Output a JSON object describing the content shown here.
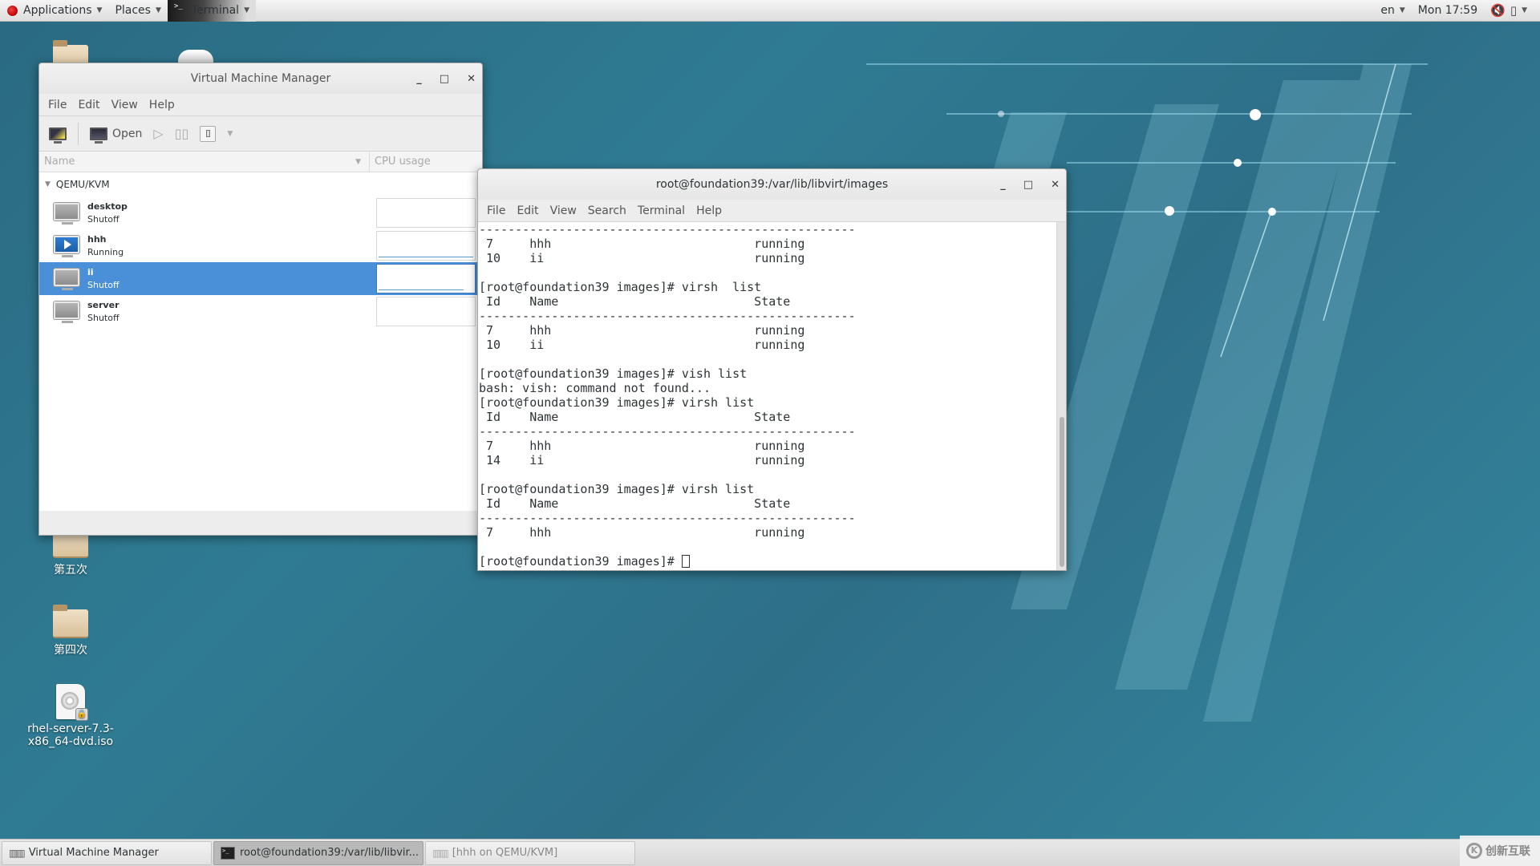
{
  "top_bar": {
    "applications_label": "Applications",
    "places_label": "Places",
    "active_app_label": "Terminal",
    "language": "en",
    "clock": "Mon 17:59",
    "icons": {
      "applications": "redhat-logo-icon",
      "volume": "volume-muted-icon",
      "battery": "battery-icon",
      "menu": "chevron-down-icon"
    }
  },
  "desktop": {
    "icons": [
      {
        "label": "",
        "type": "home-folder"
      },
      {
        "label": "",
        "type": "disk"
      },
      {
        "label": "第五次",
        "type": "folder"
      },
      {
        "label": "第四次",
        "type": "folder"
      },
      {
        "label": "rhel-server-7.3-x86_64-dvd.iso",
        "line1": "rhel-server-7.3-",
        "line2": "x86_64-dvd.iso",
        "type": "iso"
      }
    ]
  },
  "vmm": {
    "title": "Virtual Machine Manager",
    "menu": [
      "File",
      "Edit",
      "View",
      "Help"
    ],
    "toolbar": {
      "open_label": "Open"
    },
    "columns": {
      "name": "Name",
      "cpu": "CPU usage"
    },
    "group": "QEMU/KVM",
    "vms": [
      {
        "name": "desktop",
        "status": "Shutoff",
        "running": false,
        "selected": false
      },
      {
        "name": "hhh",
        "status": "Running",
        "running": true,
        "selected": false
      },
      {
        "name": "ii",
        "status": "Shutoff",
        "running": false,
        "selected": true
      },
      {
        "name": "server",
        "status": "Shutoff",
        "running": false,
        "selected": false
      }
    ],
    "accent_color": "#4a90d9"
  },
  "terminal": {
    "title": "root@foundation39:/var/lib/libvirt/images",
    "menu": [
      "File",
      "Edit",
      "View",
      "Search",
      "Terminal",
      "Help"
    ],
    "lines": [
      "----------------------------------------------------",
      " 7     hhh                            running",
      " 10    ii                             running",
      "",
      "[root@foundation39 images]# virsh  list",
      " Id    Name                           State",
      "----------------------------------------------------",
      " 7     hhh                            running",
      " 10    ii                             running",
      "",
      "[root@foundation39 images]# vish list",
      "bash: vish: command not found...",
      "[root@foundation39 images]# virsh list",
      " Id    Name                           State",
      "----------------------------------------------------",
      " 7     hhh                            running",
      " 14    ii                             running",
      "",
      "[root@foundation39 images]# virsh list",
      " Id    Name                           State",
      "----------------------------------------------------",
      " 7     hhh                            running",
      ""
    ],
    "prompt": "[root@foundation39 images]# ",
    "scroll_position_fraction": 0.56
  },
  "taskbar": {
    "tasks": [
      {
        "label": "Virtual Machine Manager",
        "active": false,
        "dim": false
      },
      {
        "label": "root@foundation39:/var/lib/libvir...",
        "active": true,
        "dim": false
      },
      {
        "label": "[hhh on QEMU/KVM]",
        "active": false,
        "dim": true
      }
    ]
  },
  "watermark": {
    "text": "创新互联"
  }
}
